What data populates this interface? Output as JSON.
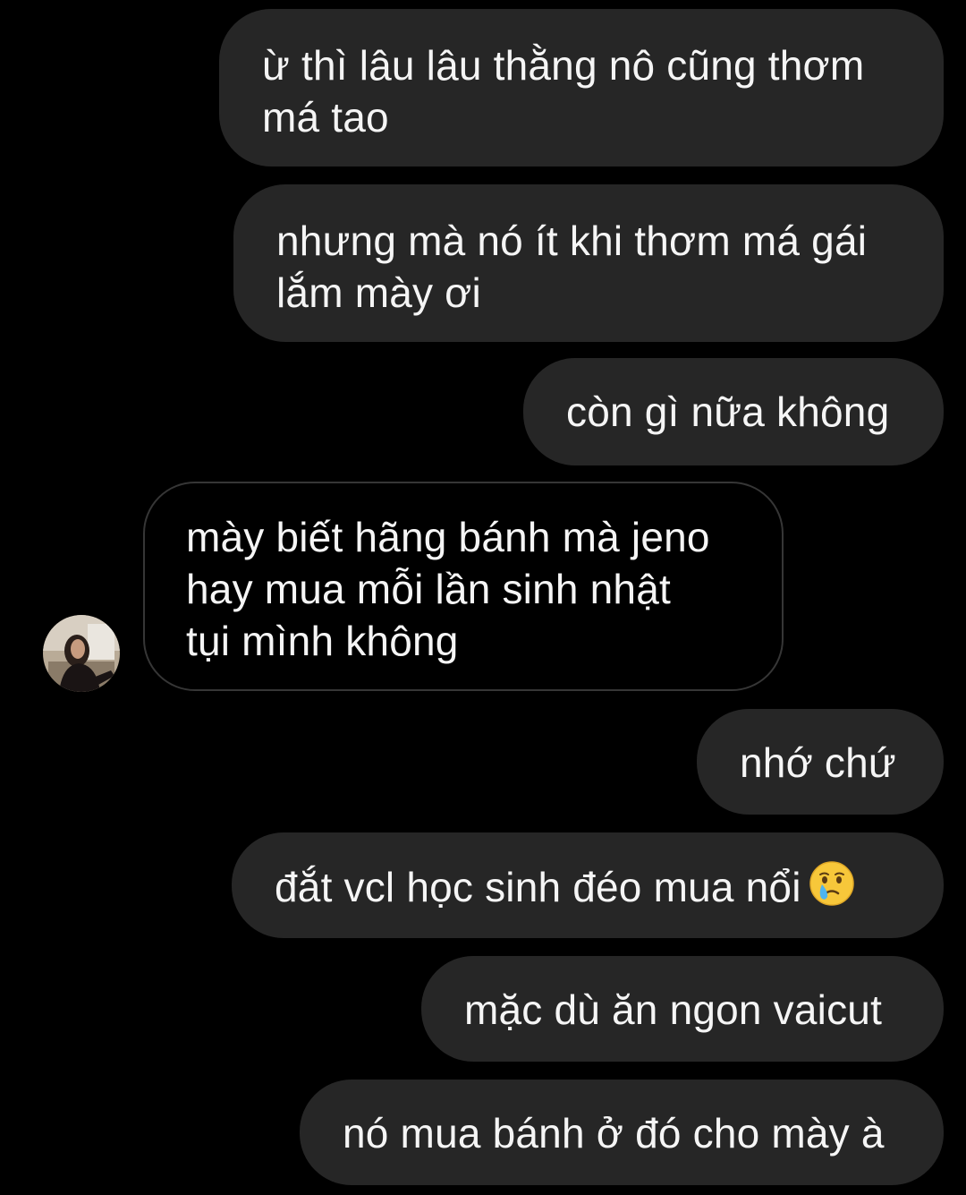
{
  "messages": [
    {
      "direction": "sent",
      "text": "ừ thì lâu lâu thằng nô cũng thơm\nmá tao"
    },
    {
      "direction": "sent",
      "text": "nhưng mà nó ít khi thơm má gái\nlắm mày ơi"
    },
    {
      "direction": "sent",
      "text": "còn gì nữa không"
    },
    {
      "direction": "received",
      "text": "mày biết hãng bánh mà jeno\nhay mua mỗi lần sinh nhật\ntụi mình không"
    },
    {
      "direction": "sent",
      "text": "nhớ chứ"
    },
    {
      "direction": "sent",
      "text": "đắt vcl học sinh đéo mua nổi",
      "emoji": "face-holding-back-tears-emoji"
    },
    {
      "direction": "sent",
      "text": "mặc dù ăn ngon vaicut"
    },
    {
      "direction": "sent",
      "text": "nó mua bánh ở đó cho mày à"
    }
  ],
  "colors": {
    "background": "#000000",
    "sent_bubble": "#262626",
    "received_border": "#363636",
    "text": "#f5f5f5"
  },
  "icons": {
    "avatar": "contact-avatar-photo"
  }
}
